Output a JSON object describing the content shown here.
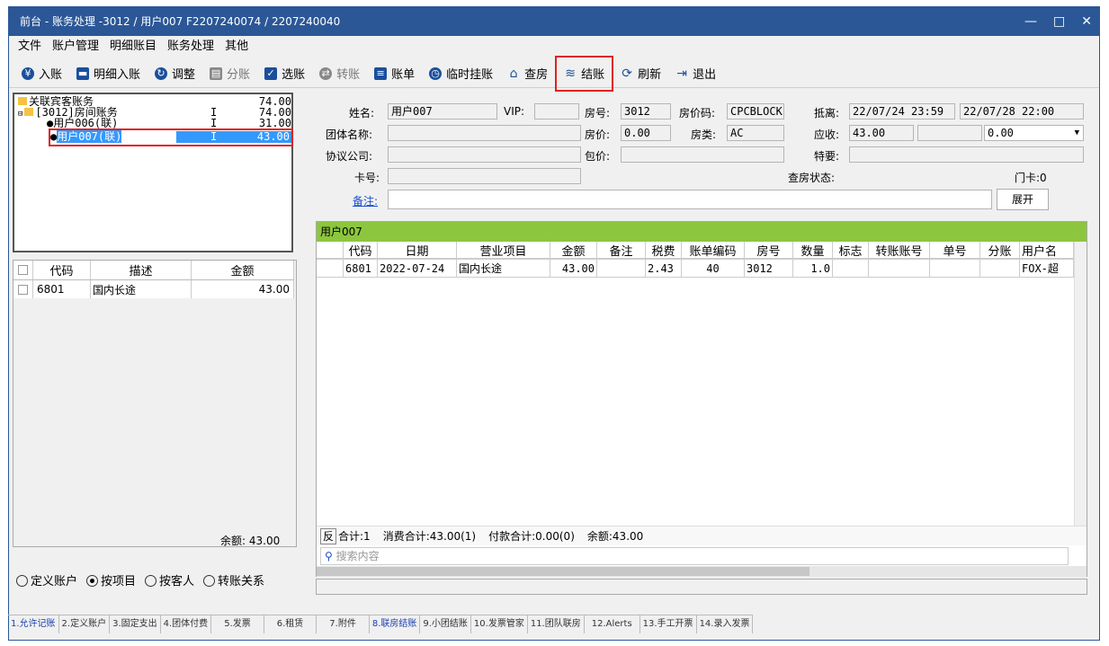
{
  "title": "前台 - 账务处理 -3012 / 用户007 F2207240074 / 2207240040",
  "window_controls": {
    "minimize": "—",
    "maximize": "□",
    "close": "✕"
  },
  "menu": [
    "文件",
    "账户管理",
    "明细账目",
    "账务处理",
    "其他"
  ],
  "toolbar": [
    {
      "label": "入账",
      "icon": "yen-icon",
      "glyph": "¥",
      "enabled": true
    },
    {
      "label": "明细入账",
      "icon": "monitor-icon",
      "glyph": "▬",
      "enabled": true
    },
    {
      "label": "调整",
      "icon": "adjust-icon",
      "glyph": "↻",
      "enabled": true
    },
    {
      "label": "分账",
      "icon": "split-icon",
      "glyph": "▤",
      "enabled": false
    },
    {
      "label": "选账",
      "icon": "select-icon",
      "glyph": "✓",
      "enabled": true
    },
    {
      "label": "转账",
      "icon": "transfer-icon",
      "glyph": "⇄",
      "enabled": false
    },
    {
      "label": "账单",
      "icon": "bill-icon",
      "glyph": "≡",
      "enabled": true
    },
    {
      "label": "临时挂账",
      "icon": "clock-icon",
      "glyph": "◷",
      "enabled": true
    },
    {
      "label": "查房",
      "icon": "house-icon",
      "glyph": "⌂",
      "enabled": true
    },
    {
      "label": "结账",
      "icon": "database-icon",
      "glyph": "≋",
      "enabled": true,
      "highlighted": true
    },
    {
      "label": "刷新",
      "icon": "refresh-icon",
      "glyph": "⟳",
      "enabled": true
    },
    {
      "label": "退出",
      "icon": "exit-icon",
      "glyph": "⇥",
      "enabled": true
    }
  ],
  "tree": {
    "root": {
      "label": "关联宾客账务",
      "amount": "74.00"
    },
    "room": {
      "label": "[3012]房间账务",
      "flag": "I",
      "amount": "74.00"
    },
    "child1": {
      "label": "用户006(联)",
      "flag": "I",
      "amount": "31.00"
    },
    "child2": {
      "label": "用户007(联)",
      "flag": "I",
      "amount": "43.00",
      "selected": true
    }
  },
  "left_grid": {
    "headers": [
      "代码",
      "描述",
      "金额"
    ],
    "rows": [
      {
        "code": "6801",
        "desc": "国内长途",
        "amount": "43.00"
      }
    ],
    "balance_label": "余额: 43.00"
  },
  "radios": {
    "options": [
      "定义账户",
      "按项目",
      "按客人",
      "转账关系"
    ],
    "selected": "按项目"
  },
  "info": {
    "name_label": "姓名:",
    "name": "用户007",
    "vip_label": "VIP:",
    "vip": "",
    "room_label": "房号:",
    "room": "3012",
    "rate_code_label": "房价码:",
    "rate_code": "CPCBLOCK",
    "arrival_label": "抵离:",
    "arrival": "22/07/24 23:59",
    "departure": "22/07/28 22:00",
    "group_label": "团体名称:",
    "group": "",
    "price_label": "房价:",
    "price": "0.00",
    "room_type_label": "房类:",
    "room_type": "AC",
    "receivable_label": "应收:",
    "receivable": "43.00",
    "receivable2": "",
    "receivable3": "0.00",
    "company_label": "协议公司:",
    "company": "",
    "package_label": "包价:",
    "package": "",
    "special_label": "特要:",
    "special": "",
    "card_label": "卡号:",
    "card": "",
    "checkroom_label": "查房状态:",
    "checkroom": "",
    "doorcard_label": "门卡:",
    "doorcard": "0",
    "remark_label": "备注:",
    "remark": "",
    "expand_button": "展开"
  },
  "detail": {
    "group_title": "用户007",
    "headers": [
      "代码",
      "日期",
      "营业项目",
      "金额",
      "备注",
      "税费",
      "账单编码",
      "房号",
      "数量",
      "标志",
      "转账账号",
      "单号",
      "分账",
      "用户名"
    ],
    "rows": [
      {
        "code": "6801",
        "date": "2022-07-24",
        "item": "国内长途",
        "amount": "43.00",
        "remark": "",
        "tax": "2.43",
        "bill": "40",
        "room": "3012",
        "qty": "1.0",
        "flag": "",
        "transfer": "",
        "order": "",
        "split": "",
        "user": "FOX-超"
      }
    ],
    "summary": {
      "reverse": "反",
      "count": "合计:1",
      "consume": "消费合计:43.00(1)",
      "payment": "付款合计:0.00(0)",
      "balance": "余额:43.00"
    },
    "search_placeholder": "搜索内容"
  },
  "tabs": [
    {
      "label": "1.允许记账",
      "active": true
    },
    {
      "label": "2.定义账户"
    },
    {
      "label": "3.固定支出"
    },
    {
      "label": "4.团体付费"
    },
    {
      "label": "5.发票"
    },
    {
      "label": "6.租赁"
    },
    {
      "label": "7.附件"
    },
    {
      "label": "8.联房结账",
      "active": true
    },
    {
      "label": "9.小团结账"
    },
    {
      "label": "10.发票管家"
    },
    {
      "label": "11.团队联房"
    },
    {
      "label": "12.Alerts"
    },
    {
      "label": "13.手工开票"
    },
    {
      "label": "14.录入发票"
    }
  ]
}
